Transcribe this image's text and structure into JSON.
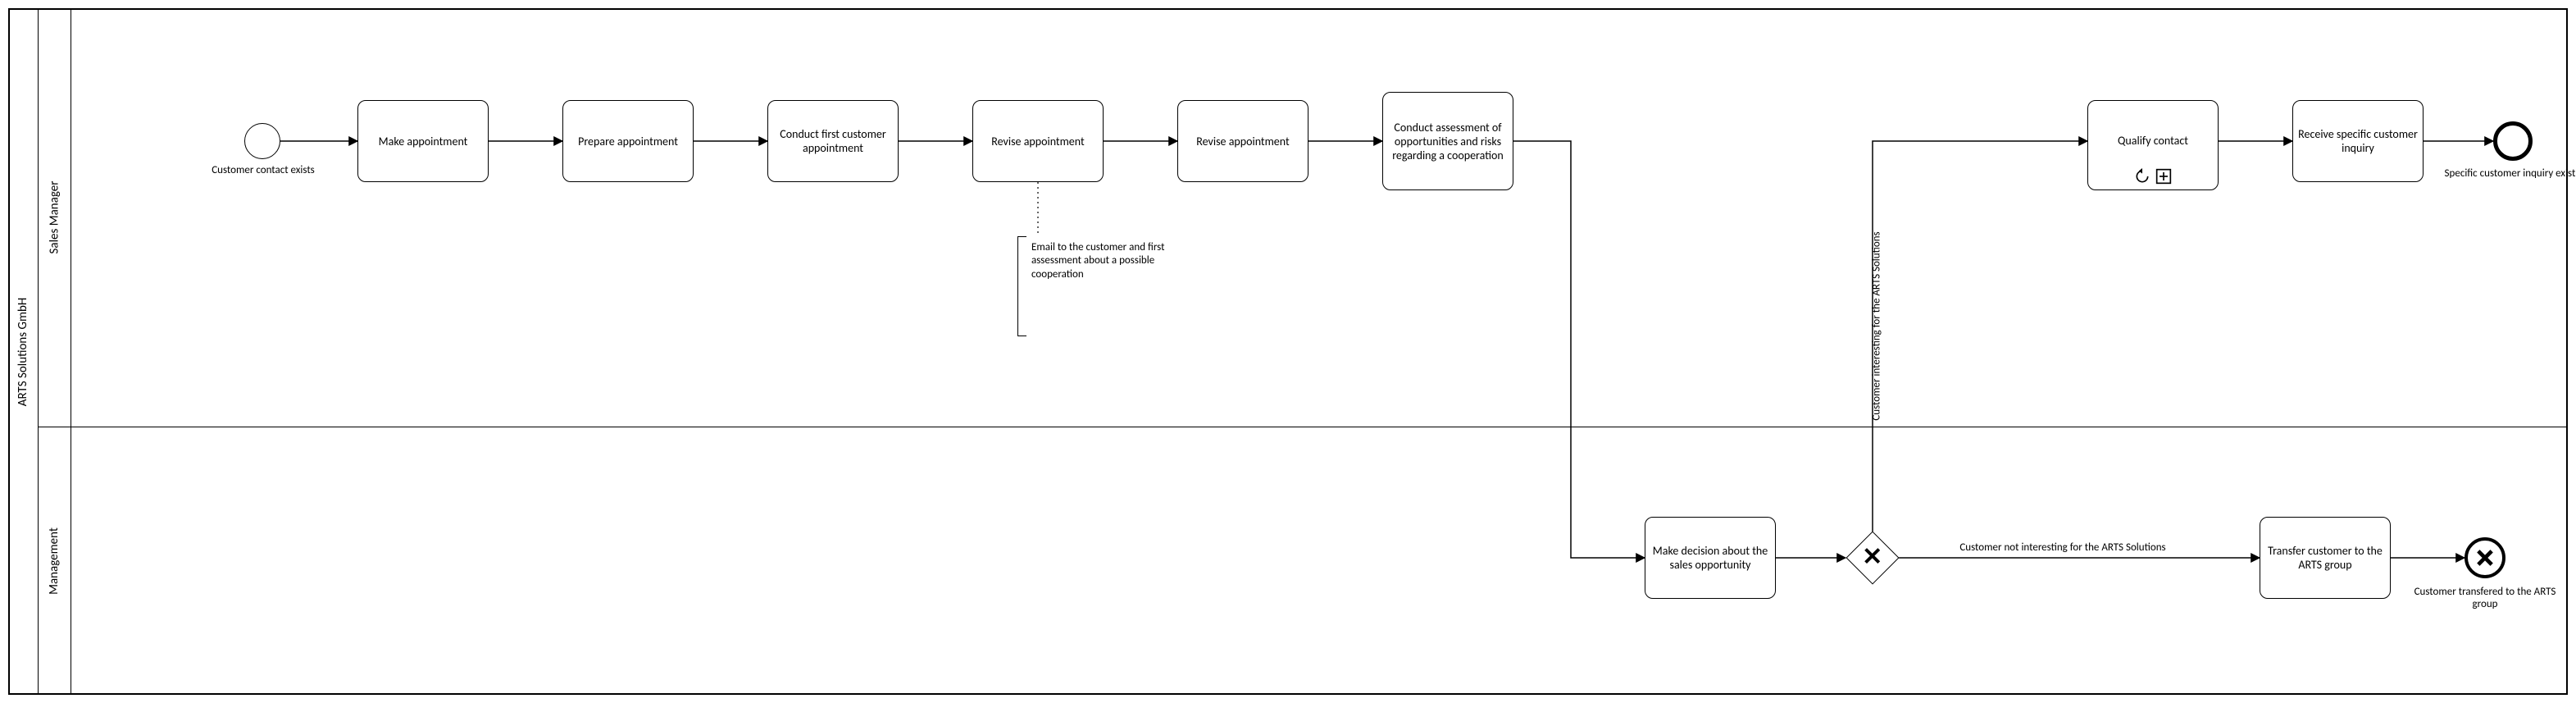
{
  "pool": {
    "label": "ARTS Solutions GmbH"
  },
  "lanes": {
    "sales": {
      "label": "Sales Manager"
    },
    "mgmt": {
      "label": "Management"
    }
  },
  "events": {
    "start": {
      "label": "Customer contact exists"
    },
    "end1": {
      "label": "Specific customer inquiry exists"
    },
    "end2": {
      "label": "Customer transfered to the ARTS group"
    }
  },
  "tasks": {
    "t1": "Make appointment",
    "t2": "Prepare appointment",
    "t3": "Conduct first customer appointment",
    "t4": "Revise appointment",
    "t5": "Conduct assessment of opportunities and risks regarding a cooperation",
    "t6": "Qualify contact",
    "t7": "Receive specific customer inquiry",
    "m1": "Make decision about the sales opportunity",
    "m2": "Transfer customer to the ARTS group"
  },
  "annotation": {
    "a1": "Email to the customer and first assessment about a possible cooperation"
  },
  "flowLabels": {
    "up": "Customer interesting for the ARTS Solutions",
    "right": "Customer not interesting for the ARTS Solutions"
  }
}
